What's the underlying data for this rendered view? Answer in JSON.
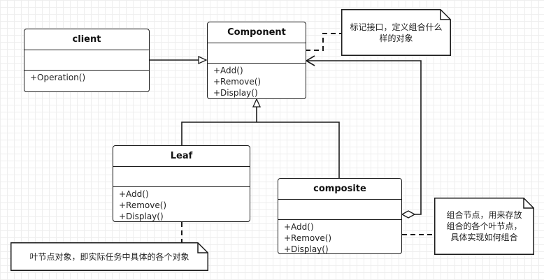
{
  "classes": {
    "client": {
      "name": "client",
      "ops": [
        "+Operation()"
      ]
    },
    "component": {
      "name": "Component",
      "ops": [
        "+Add()",
        "+Remove()",
        "+Display()"
      ]
    },
    "leaf": {
      "name": "Leaf",
      "ops": [
        "+Add()",
        "+Remove()",
        "+Display()"
      ]
    },
    "composite": {
      "name": "composite",
      "ops": [
        "+Add()",
        "+Remove()",
        "+Display()"
      ]
    }
  },
  "notes": {
    "component": "标记接口，定义组合什么样的对象",
    "leaf": "叶节点对象，即实际任务中具体的各个对象",
    "composite": "组合节点，用来存放组合的各个叶节点，具体实现如何组合"
  }
}
